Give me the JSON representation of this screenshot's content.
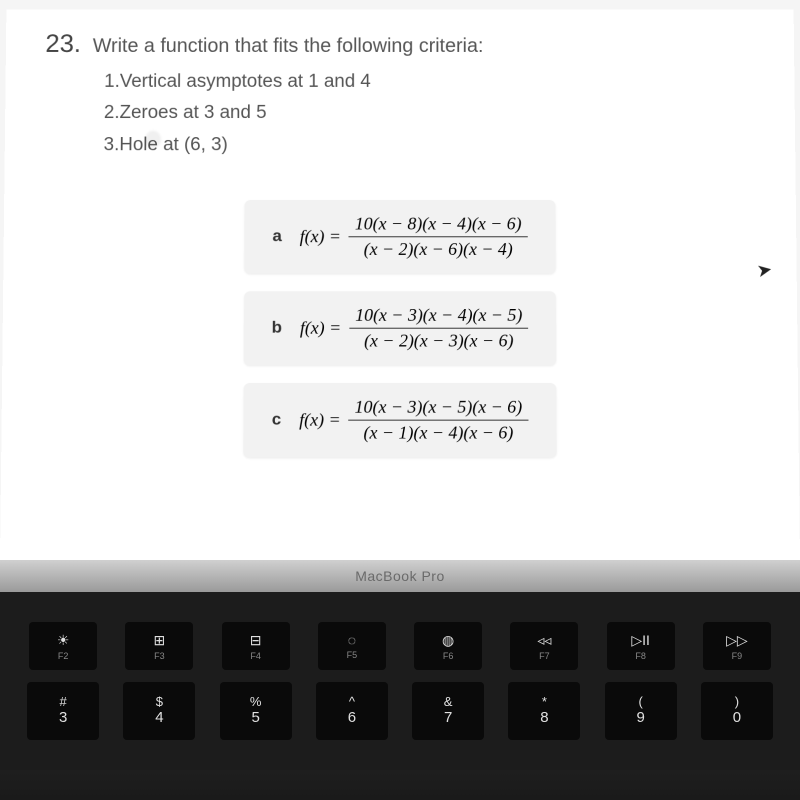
{
  "question": {
    "number": "23.",
    "prompt": "Write a function that fits the following criteria:",
    "criteria": [
      "1.Vertical asymptotes at 1 and 4",
      "2.Zeroes at 3 and 5",
      "3.Hole at (6, 3)"
    ]
  },
  "answers": [
    {
      "letter": "a",
      "lhs": "f(x) =",
      "numerator": "10(x − 8)(x − 4)(x − 6)",
      "denominator": "(x − 2)(x − 6)(x − 4)"
    },
    {
      "letter": "b",
      "lhs": "f(x) =",
      "numerator": "10(x − 3)(x − 4)(x − 5)",
      "denominator": "(x − 2)(x − 3)(x − 6)"
    },
    {
      "letter": "c",
      "lhs": "f(x) =",
      "numerator": "10(x − 3)(x − 5)(x − 6)",
      "denominator": "(x − 1)(x − 4)(x − 6)"
    }
  ],
  "laptop": {
    "brand": "MacBook Pro",
    "fn_keys": [
      {
        "icon": "☀",
        "label": "F2"
      },
      {
        "icon": "⊞",
        "label": "F3"
      },
      {
        "icon": "⊟",
        "label": "F4"
      },
      {
        "icon": "◌",
        "label": "F5"
      },
      {
        "icon": "◍",
        "label": "F6"
      },
      {
        "icon": "◃◃",
        "label": "F7"
      },
      {
        "icon": "▷II",
        "label": "F8"
      },
      {
        "icon": "▷▷",
        "label": "F9"
      }
    ],
    "num_keys": [
      {
        "top": "#",
        "bottom": "3"
      },
      {
        "top": "$",
        "bottom": "4"
      },
      {
        "top": "%",
        "bottom": "5"
      },
      {
        "top": "^",
        "bottom": "6"
      },
      {
        "top": "&",
        "bottom": "7"
      },
      {
        "top": "*",
        "bottom": "8"
      },
      {
        "top": "(",
        "bottom": "9"
      },
      {
        "top": ")",
        "bottom": "0"
      }
    ]
  }
}
